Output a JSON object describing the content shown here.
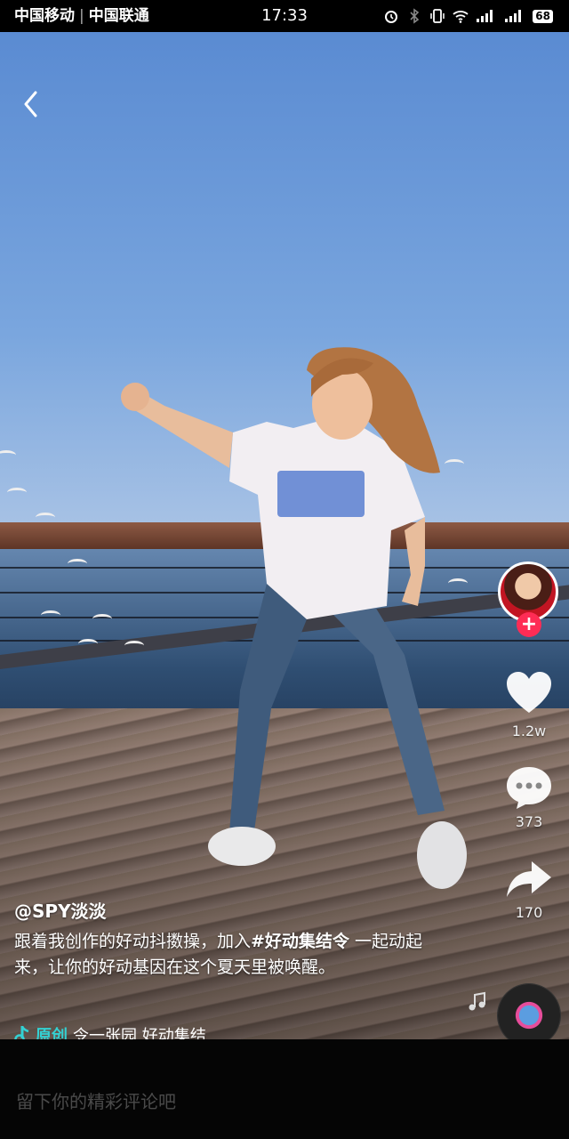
{
  "status_bar": {
    "carrier1": "中国移动",
    "carrier2": "中国联通",
    "time": "17:33",
    "battery": "68"
  },
  "video": {
    "author": "@SPY淡淡",
    "caption_prefix": "跟着我创作的好动抖擞操，加入",
    "caption_hashtag": "#好动集结令",
    "caption_suffix": " 一起动起来，让你的好动基因在这个夏天里被唤醒。",
    "music_tag": "原创",
    "music_text": "令一张园    好动集结"
  },
  "actions": {
    "likes": "1.2w",
    "comments": "373",
    "shares": "170"
  },
  "comment_bar": {
    "placeholder": "留下你的精彩评论吧"
  }
}
